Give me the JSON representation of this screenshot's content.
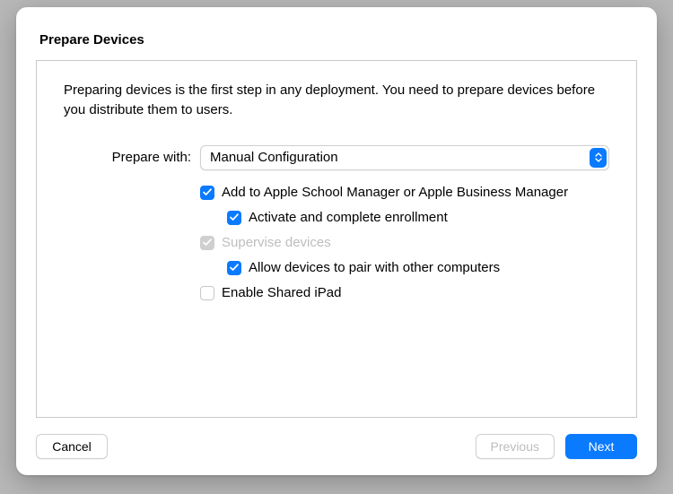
{
  "title": "Prepare Devices",
  "intro": "Preparing devices is the first step in any deployment. You need to prepare devices before you distribute them to users.",
  "form": {
    "prepare_with_label": "Prepare with:",
    "prepare_with_value": "Manual Configuration"
  },
  "options": {
    "add_manager": "Add to Apple School Manager or Apple Business Manager",
    "activate": "Activate and complete enrollment",
    "supervise": "Supervise devices",
    "allow_pair": "Allow devices to pair with other computers",
    "shared_ipad": "Enable Shared iPad"
  },
  "buttons": {
    "cancel": "Cancel",
    "previous": "Previous",
    "next": "Next"
  }
}
